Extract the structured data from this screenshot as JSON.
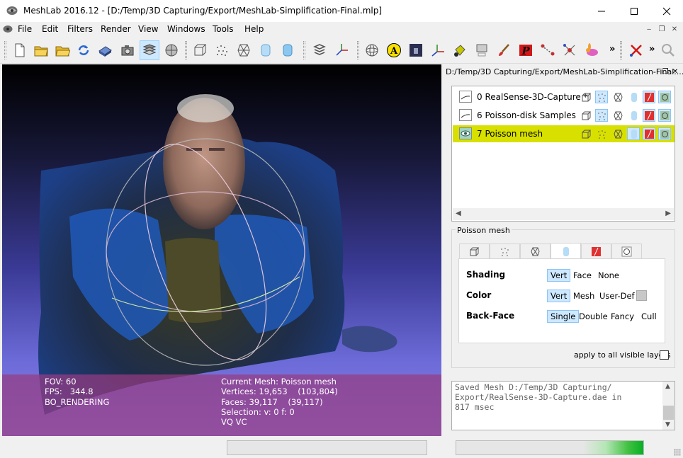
{
  "window": {
    "title": "MeshLab 2016.12 - [D:/Temp/3D Capturing/Export/MeshLab-Simplification-Final.mlp]",
    "minimize_icon": "minimize-icon",
    "maximize_icon": "maximize-icon",
    "close_icon": "close-icon"
  },
  "menu": {
    "items": [
      "File",
      "Edit",
      "Filters",
      "Render",
      "View",
      "Windows",
      "Tools",
      "Help"
    ]
  },
  "toolbar": {
    "overflow_1": "»",
    "overflow_2": "»",
    "icons": [
      "new-project-icon",
      "open-project-icon",
      "open-mesh-icon",
      "reload-icon",
      "save-icon",
      "snapshot-icon",
      "show-layers-icon",
      "plane-view-icon",
      "bbox-icon",
      "points-icon",
      "wireframe-icon",
      "flat-icon",
      "smooth-icon",
      "texture-icon",
      "axis-icon",
      "trackball-icon",
      "annotation-icon",
      "dark-box-icon",
      "axis-align-icon",
      "paint-icon",
      "align-icon",
      "brush-icon",
      "pickpoints-icon",
      "measure-icon",
      "select-icon",
      "bunny-icon",
      "stop-icon",
      "search-icon"
    ]
  },
  "viewport": {
    "info_left": [
      "FOV: 60",
      "FPS:   344.8",
      "BO_RENDERING"
    ],
    "info_right": [
      "Current Mesh: Poisson mesh",
      "Vertices: 19,653    (103,804)",
      "Faces: 39,117    (39,117)",
      "Selection: v: 0 f: 0",
      "VQ VC"
    ]
  },
  "layer_dock": {
    "title": "D:/Temp/3D Capturing/Export/MeshLab-Simplification-Final....",
    "layers": [
      {
        "label": "0  RealSense-3D-Capture *",
        "visible": true,
        "selected": false
      },
      {
        "label": "6  Poisson-disk Samples",
        "visible": true,
        "selected": false
      },
      {
        "label": "7  Poisson mesh",
        "visible": true,
        "selected": true
      }
    ]
  },
  "decorator": {
    "group_title": "Poisson mesh",
    "rows": [
      {
        "label": "Shading",
        "options": [
          "Vert",
          "Face",
          "None"
        ],
        "selected": "Vert"
      },
      {
        "label": "Color",
        "options": [
          "Vert",
          "Mesh",
          "User-Def"
        ],
        "selected": "Vert"
      },
      {
        "label": "Back-Face",
        "options": [
          "Single",
          "Double",
          "Fancy",
          "Cull"
        ],
        "selected": "Single"
      }
    ],
    "apply_all": "apply to all visible layers",
    "apply_all_checked": false
  },
  "log": {
    "text": "Saved Mesh D:/Temp/3D Capturing/\nExport/RealSense-3D-Capture.dae in\n817 msec"
  },
  "status": {
    "progress": 0.3
  },
  "colors": {
    "selected_layer": "#d8e000",
    "info_band": "#963c82",
    "toggle_active": "#cde8ff",
    "progress_green": "#06b025"
  }
}
